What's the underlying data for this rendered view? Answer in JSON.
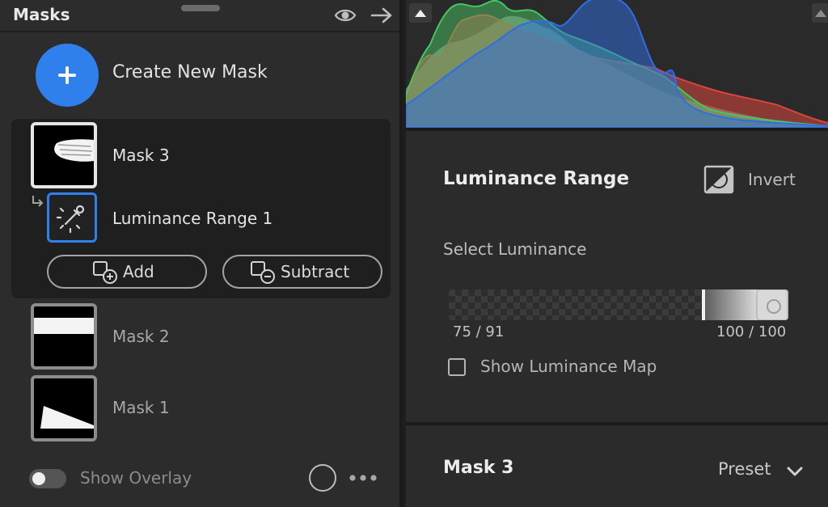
{
  "panel": {
    "title": "Masks"
  },
  "create": {
    "label": "Create New Mask"
  },
  "masks": [
    {
      "label": "Mask 3",
      "selected": true,
      "components": [
        {
          "label": "Luminance Range 1",
          "icon": "eyedropper-icon"
        }
      ],
      "add_label": "Add",
      "subtract_label": "Subtract"
    },
    {
      "label": "Mask 2",
      "selected": false
    },
    {
      "label": "Mask 1",
      "selected": false
    }
  ],
  "footer": {
    "overlay_label": "Show Overlay",
    "overlay_on": false
  },
  "luminance": {
    "title": "Luminance Range",
    "invert_label": "Invert",
    "select_label": "Select Luminance",
    "left_readout": "75 / 91",
    "right_readout": "100 / 100",
    "range_start": 75,
    "range_full": 91,
    "range_end": 100,
    "show_map_label": "Show Luminance Map",
    "show_map_checked": false
  },
  "mask_section": {
    "title": "Mask 3",
    "preset_label": "Preset"
  },
  "colors": {
    "accent": "#2f80ec",
    "hist_red": "#d9453e",
    "hist_green": "#47c464",
    "hist_blue": "#2f6de6"
  }
}
